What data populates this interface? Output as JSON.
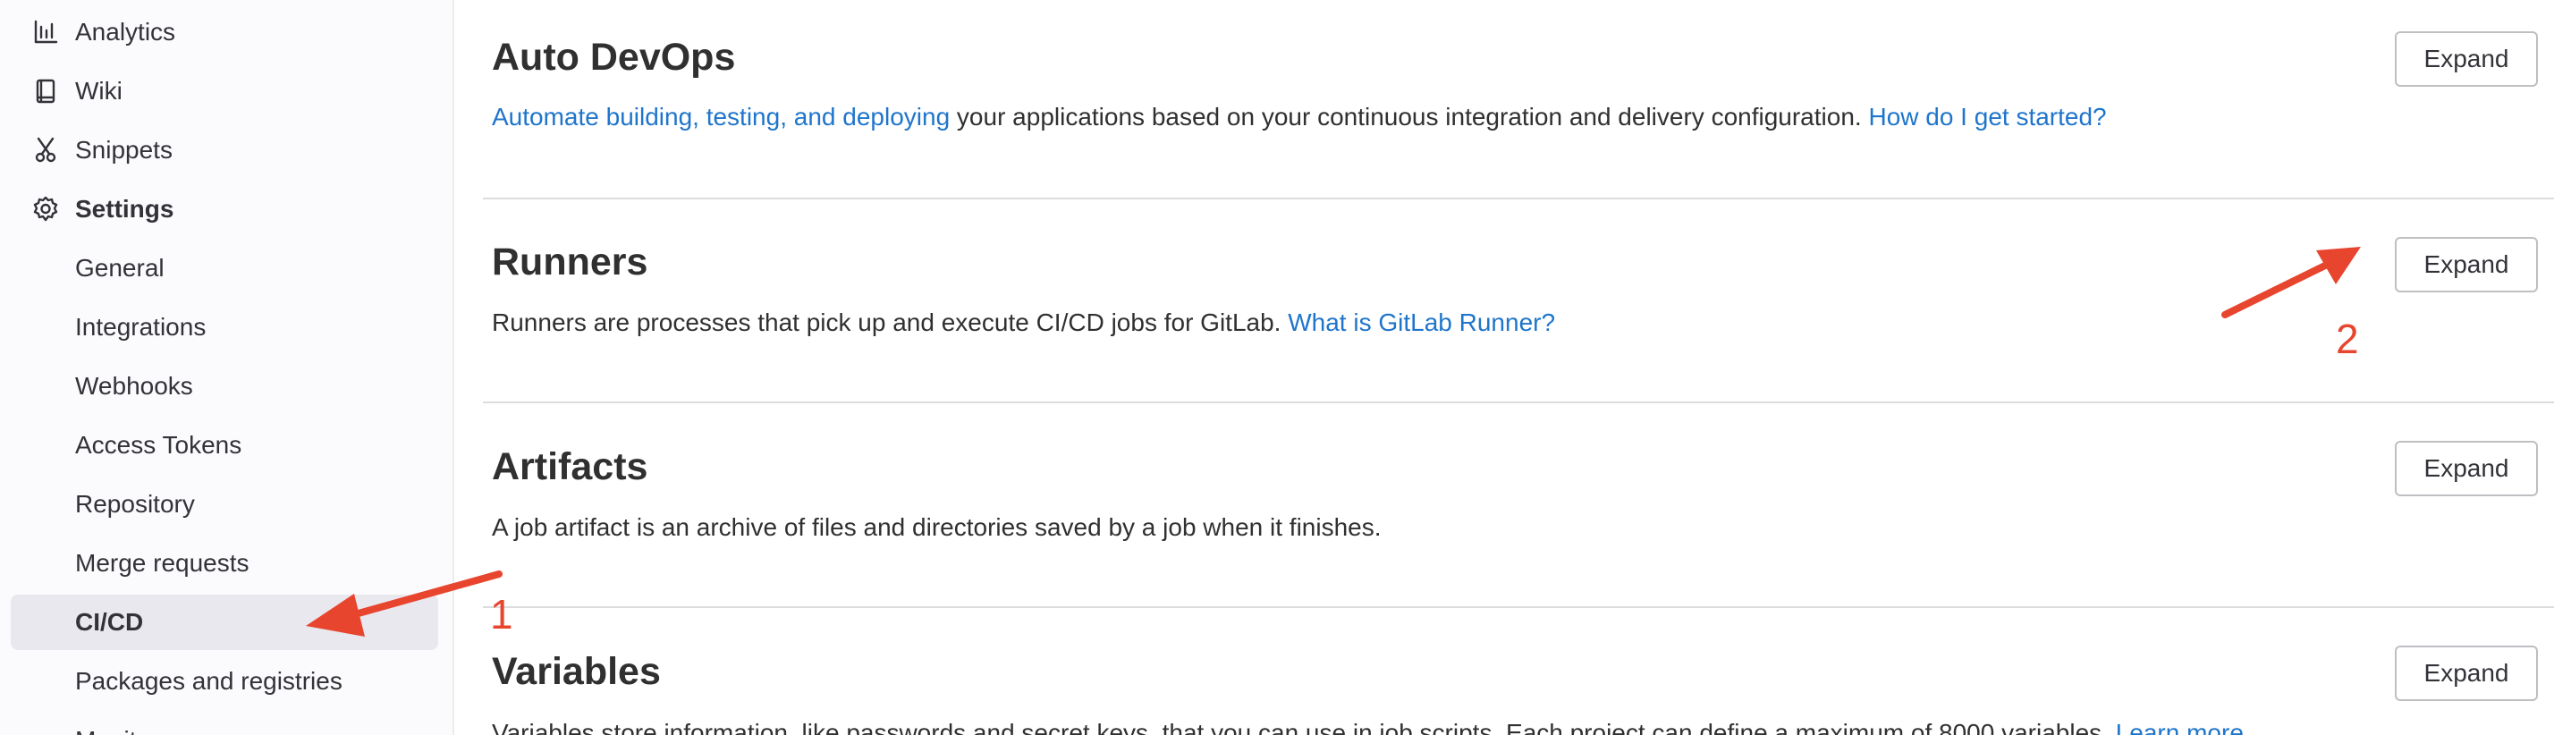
{
  "sidebar": {
    "items": [
      {
        "label": "Analytics",
        "icon": "chart-icon"
      },
      {
        "label": "Wiki",
        "icon": "book-icon"
      },
      {
        "label": "Snippets",
        "icon": "scissors-icon"
      },
      {
        "label": "Settings",
        "icon": "gear-icon"
      },
      {
        "label": "General"
      },
      {
        "label": "Integrations"
      },
      {
        "label": "Webhooks"
      },
      {
        "label": "Access Tokens"
      },
      {
        "label": "Repository"
      },
      {
        "label": "Merge requests"
      },
      {
        "label": "CI/CD",
        "active": true
      },
      {
        "label": "Packages and registries"
      },
      {
        "label": "Monitor"
      }
    ]
  },
  "sections": {
    "auto_devops": {
      "title": "Auto DevOps",
      "link1": "Automate building, testing, and deploying",
      "text": " your applications based on your continuous integration and delivery configuration. ",
      "link2": "How do I get started?",
      "button": "Expand"
    },
    "runners": {
      "title": "Runners",
      "text": "Runners are processes that pick up and execute CI/CD jobs for GitLab. ",
      "link": "What is GitLab Runner?",
      "button": "Expand"
    },
    "artifacts": {
      "title": "Artifacts",
      "text": "A job artifact is an archive of files and directories saved by a job when it finishes.",
      "button": "Expand"
    },
    "variables": {
      "title": "Variables",
      "text": "Variables store information, like passwords and secret keys, that you can use in job scripts. Each project can define a maximum of 8000 variables. ",
      "link": "Learn more.",
      "button": "Expand"
    }
  },
  "annotations": {
    "arrow_color": "#e8452f",
    "label1": "1",
    "label2": "2"
  },
  "colors": {
    "link": "#1f75cb",
    "sidebar_bg": "#fbfafd",
    "active_bg": "#e9e8ee",
    "annotation": "#e8452f"
  }
}
